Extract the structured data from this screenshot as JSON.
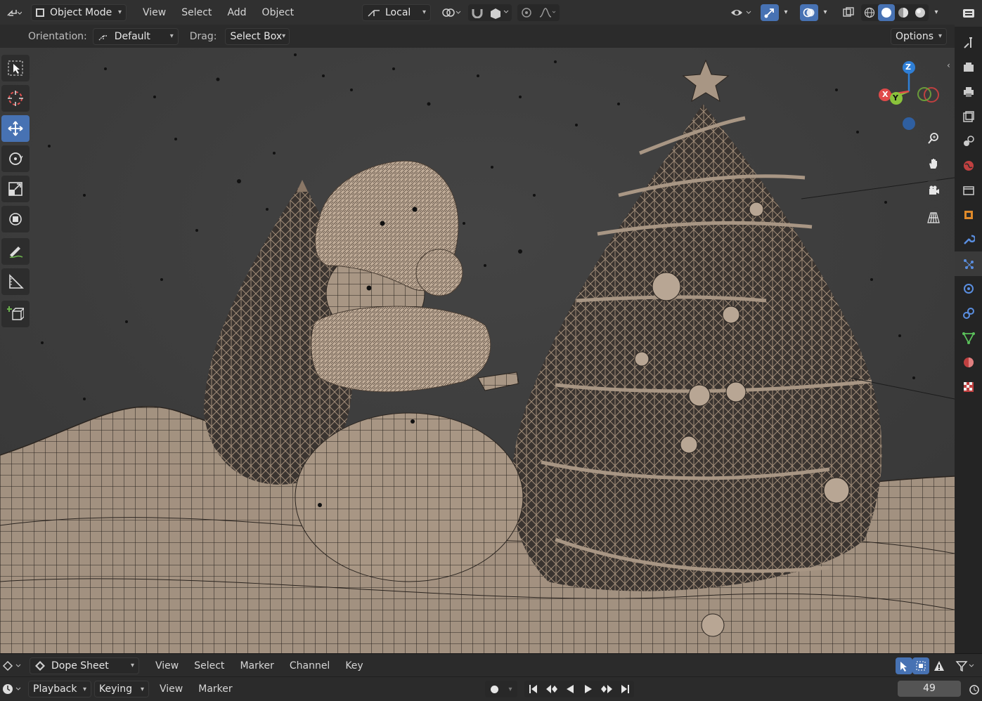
{
  "header": {
    "mode_label": "Object Mode",
    "menus": [
      "View",
      "Select",
      "Add",
      "Object"
    ],
    "transform_orientation": "Local",
    "options_label": "Options"
  },
  "tool_settings": {
    "orientation_label": "Orientation:",
    "orientation_value": "Default",
    "drag_label": "Drag:",
    "drag_value": "Select Box"
  },
  "gizmo": {
    "z": "Z",
    "y": "Y",
    "x": "X"
  },
  "dopesheet": {
    "editor_label": "Dope Sheet",
    "menus": [
      "View",
      "Select",
      "Marker",
      "Channel",
      "Key"
    ]
  },
  "timeline": {
    "menus": [
      "Playback",
      "Keying",
      "View",
      "Marker"
    ],
    "current_frame": "49"
  },
  "colors": {
    "accent": "#4772b3",
    "viewport_bg": "#3d3d3d",
    "header_bg": "#303030",
    "mesh": "#a89684"
  }
}
